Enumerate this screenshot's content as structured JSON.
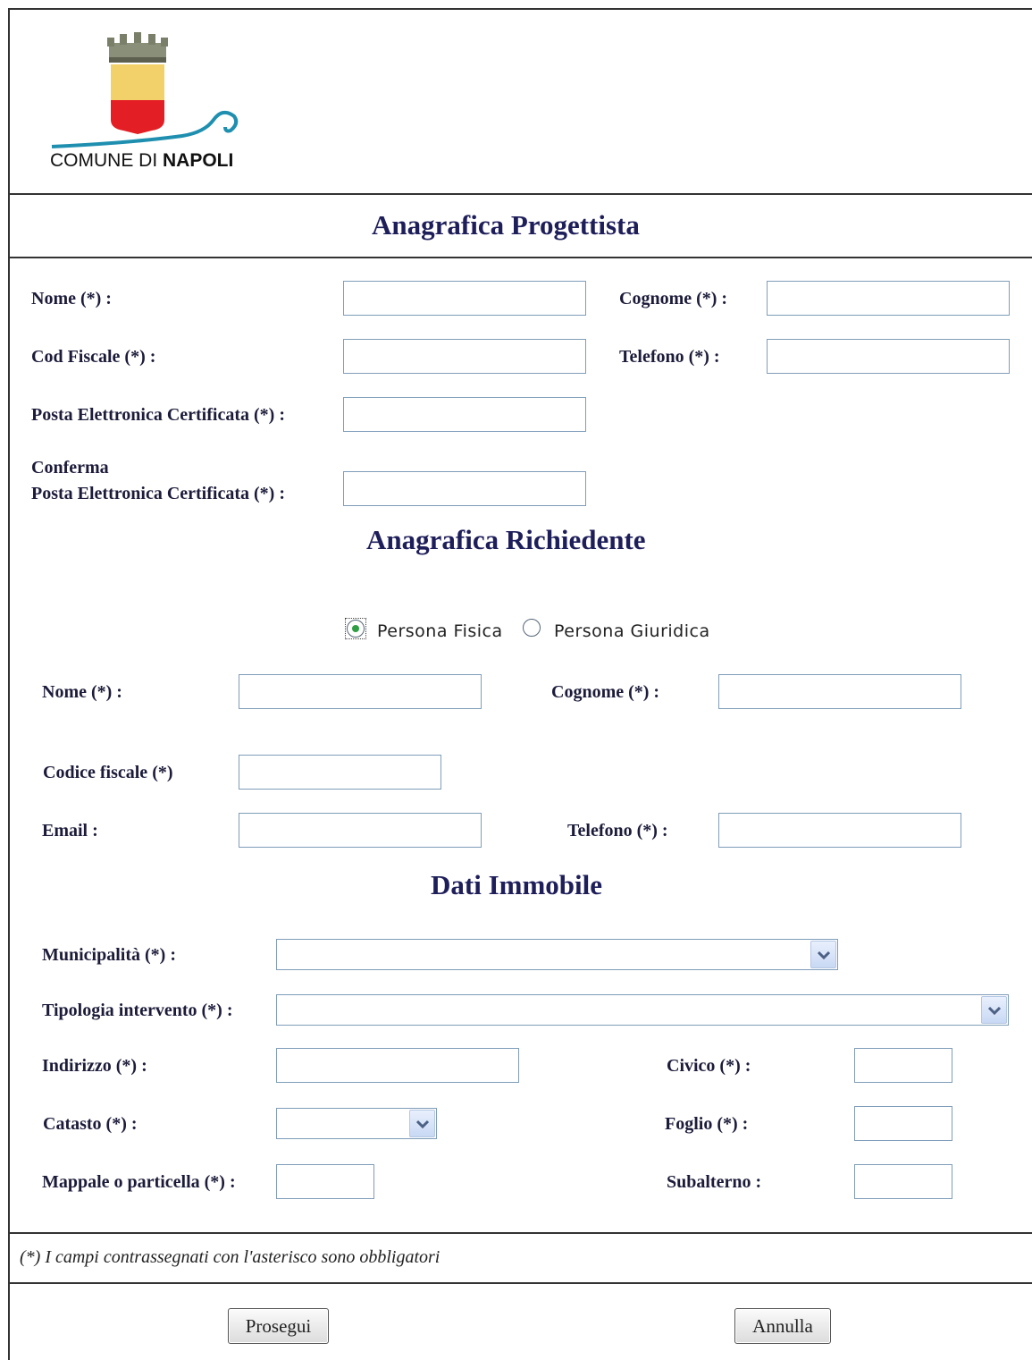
{
  "logo": {
    "text_part1": "COMUNE DI ",
    "text_part2": "NAPOLI"
  },
  "progettista": {
    "title": "Anagrafica Progettista",
    "nome_label": "Nome (*) :",
    "cognome_label": "Cognome (*) :",
    "codfiscale_label": "Cod Fiscale (*) :",
    "telefono_label": "Telefono (*) :",
    "pec_label": "Posta Elettronica Certificata (*) :",
    "conferma_line1": "Conferma",
    "conferma_line2": "Posta Elettronica Certificata (*) :",
    "nome_value": "",
    "cognome_value": "",
    "codfiscale_value": "",
    "telefono_value": "",
    "pec_value": "",
    "conferma_value": ""
  },
  "richiedente": {
    "title": "Anagrafica Richiedente",
    "radio_fisica": "Persona Fisica",
    "radio_giuridica": "Persona Giuridica",
    "selected": "Persona Fisica",
    "nome_label": "Nome (*) :",
    "cognome_label": "Cognome (*) :",
    "codicefiscale_label": "Codice fiscale (*)",
    "email_label": "Email :",
    "telefono_label": "Telefono (*) :",
    "nome_value": "",
    "cognome_value": "",
    "codicefiscale_value": "",
    "email_value": "",
    "telefono_value": ""
  },
  "immobile": {
    "title": "Dati Immobile",
    "municipalita_label": "Municipalità (*) :",
    "tipologia_label": "Tipologia intervento (*) :",
    "indirizzo_label": "Indirizzo (*) :",
    "civico_label": "Civico (*) :",
    "catasto_label": "Catasto (*) :",
    "foglio_label": "Foglio (*) :",
    "mappale_label": "Mappale o particella (*) :",
    "subalterno_label": "Subalterno :",
    "municipalita_value": "",
    "tipologia_value": "",
    "indirizzo_value": "",
    "civico_value": "",
    "catasto_value": "",
    "foglio_value": "",
    "mappale_value": "",
    "subalterno_value": ""
  },
  "footer_note": "(*) I campi contrassegnati con l'asterisco sono obbligatori",
  "buttons": {
    "prosegui": "Prosegui",
    "annulla": "Annulla"
  },
  "colors": {
    "title": "#1e1e5a",
    "input_border": "#7f9db9",
    "logo_yellow": "#f2d16b",
    "logo_red": "#e31e24",
    "logo_wave": "#1f8fb0"
  }
}
